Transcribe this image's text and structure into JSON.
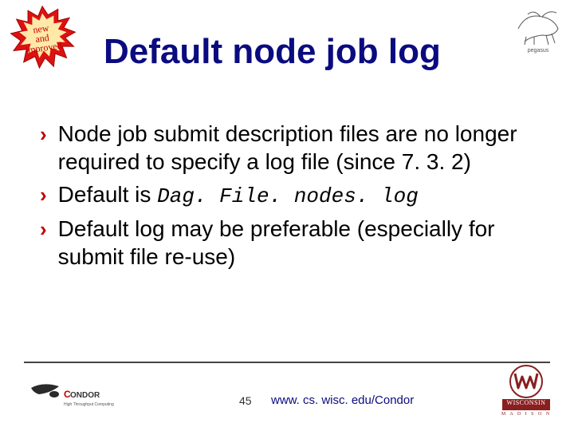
{
  "title": "Default node job log",
  "bullets": [
    {
      "text": "Node job submit description files are no longer required to specify a log file (since 7. 3. 2)"
    },
    {
      "text_pre": "Default is ",
      "code": "Dag. File. nodes. log"
    },
    {
      "text": "Default log may be preferable (especially for submit file re-use)"
    }
  ],
  "starburst": {
    "line1": "new",
    "line2": "and",
    "line3": "improved"
  },
  "top_right_label": "pegasus",
  "page_number": "45",
  "footer_url": "www. cs. wisc. edu/Condor",
  "wisconsin_label": "WISCONSIN",
  "wisconsin_sub": "M A D I S O N"
}
